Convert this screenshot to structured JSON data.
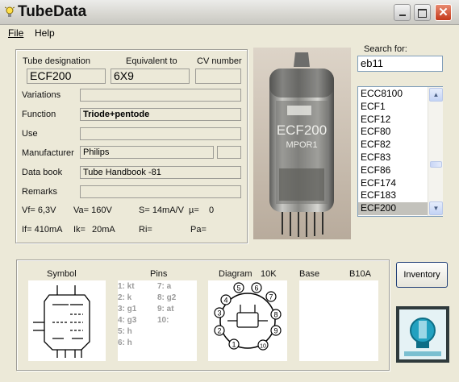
{
  "window": {
    "title": "TubeData"
  },
  "menu": {
    "file": "File",
    "help": "Help"
  },
  "labels": {
    "tube_designation": "Tube designation",
    "equivalent_to": "Equivalent to",
    "cv_number": "CV number",
    "variations": "Variations",
    "function": "Function",
    "use": "Use",
    "manufacturer": "Manufacturer",
    "data_book": "Data book",
    "remarks": "Remarks"
  },
  "fields": {
    "tube_designation": "ECF200",
    "equivalent_to": "6X9",
    "cv_number": "",
    "variations": "",
    "function": "Triode+pentode",
    "use": "",
    "manufacturer": "Philips",
    "manufacturer_code": "",
    "data_book": "Tube Handbook -81",
    "remarks": ""
  },
  "specs": {
    "vf": "Vf= 6,3V",
    "va": "Va= 160V",
    "s": "S= 14mA/V",
    "mu": "µ=",
    "mu_val": "0",
    "if": "If= 410mA",
    "ik": "Ik=",
    "ik_val": "20mA",
    "ri": "Ri=",
    "pa": "Pa="
  },
  "search": {
    "label": "Search for:",
    "value": "eb11"
  },
  "tube_list": [
    "ECC8100",
    "ECF1",
    "ECF12",
    "ECF80",
    "ECF82",
    "ECF83",
    "ECF86",
    "ECF174",
    "ECF183",
    "ECF200"
  ],
  "tube_list_selected": "ECF200",
  "bottom": {
    "symbol": "Symbol",
    "pins": "Pins",
    "diagram": "Diagram",
    "diagram_code": "10K",
    "base": "Base",
    "base_code": "B10A"
  },
  "pins": {
    "left": [
      "1: kt",
      "2: k",
      "3: g1",
      "4: g3",
      "5: h",
      "6: h"
    ],
    "right": [
      "7: a",
      "8: g2",
      "9: at",
      "10:"
    ]
  },
  "diagram_pins": [
    "1",
    "2",
    "3",
    "4",
    "5",
    "6",
    "7",
    "8",
    "9",
    "10"
  ],
  "photo_text": {
    "line1": "ECF200",
    "line2": "MPOR1"
  },
  "inventory_button": "Inventory",
  "colors": {
    "window_bg": "#ece9d8",
    "close_red": "#c4391a",
    "select_bg": "#c3c2bc"
  }
}
